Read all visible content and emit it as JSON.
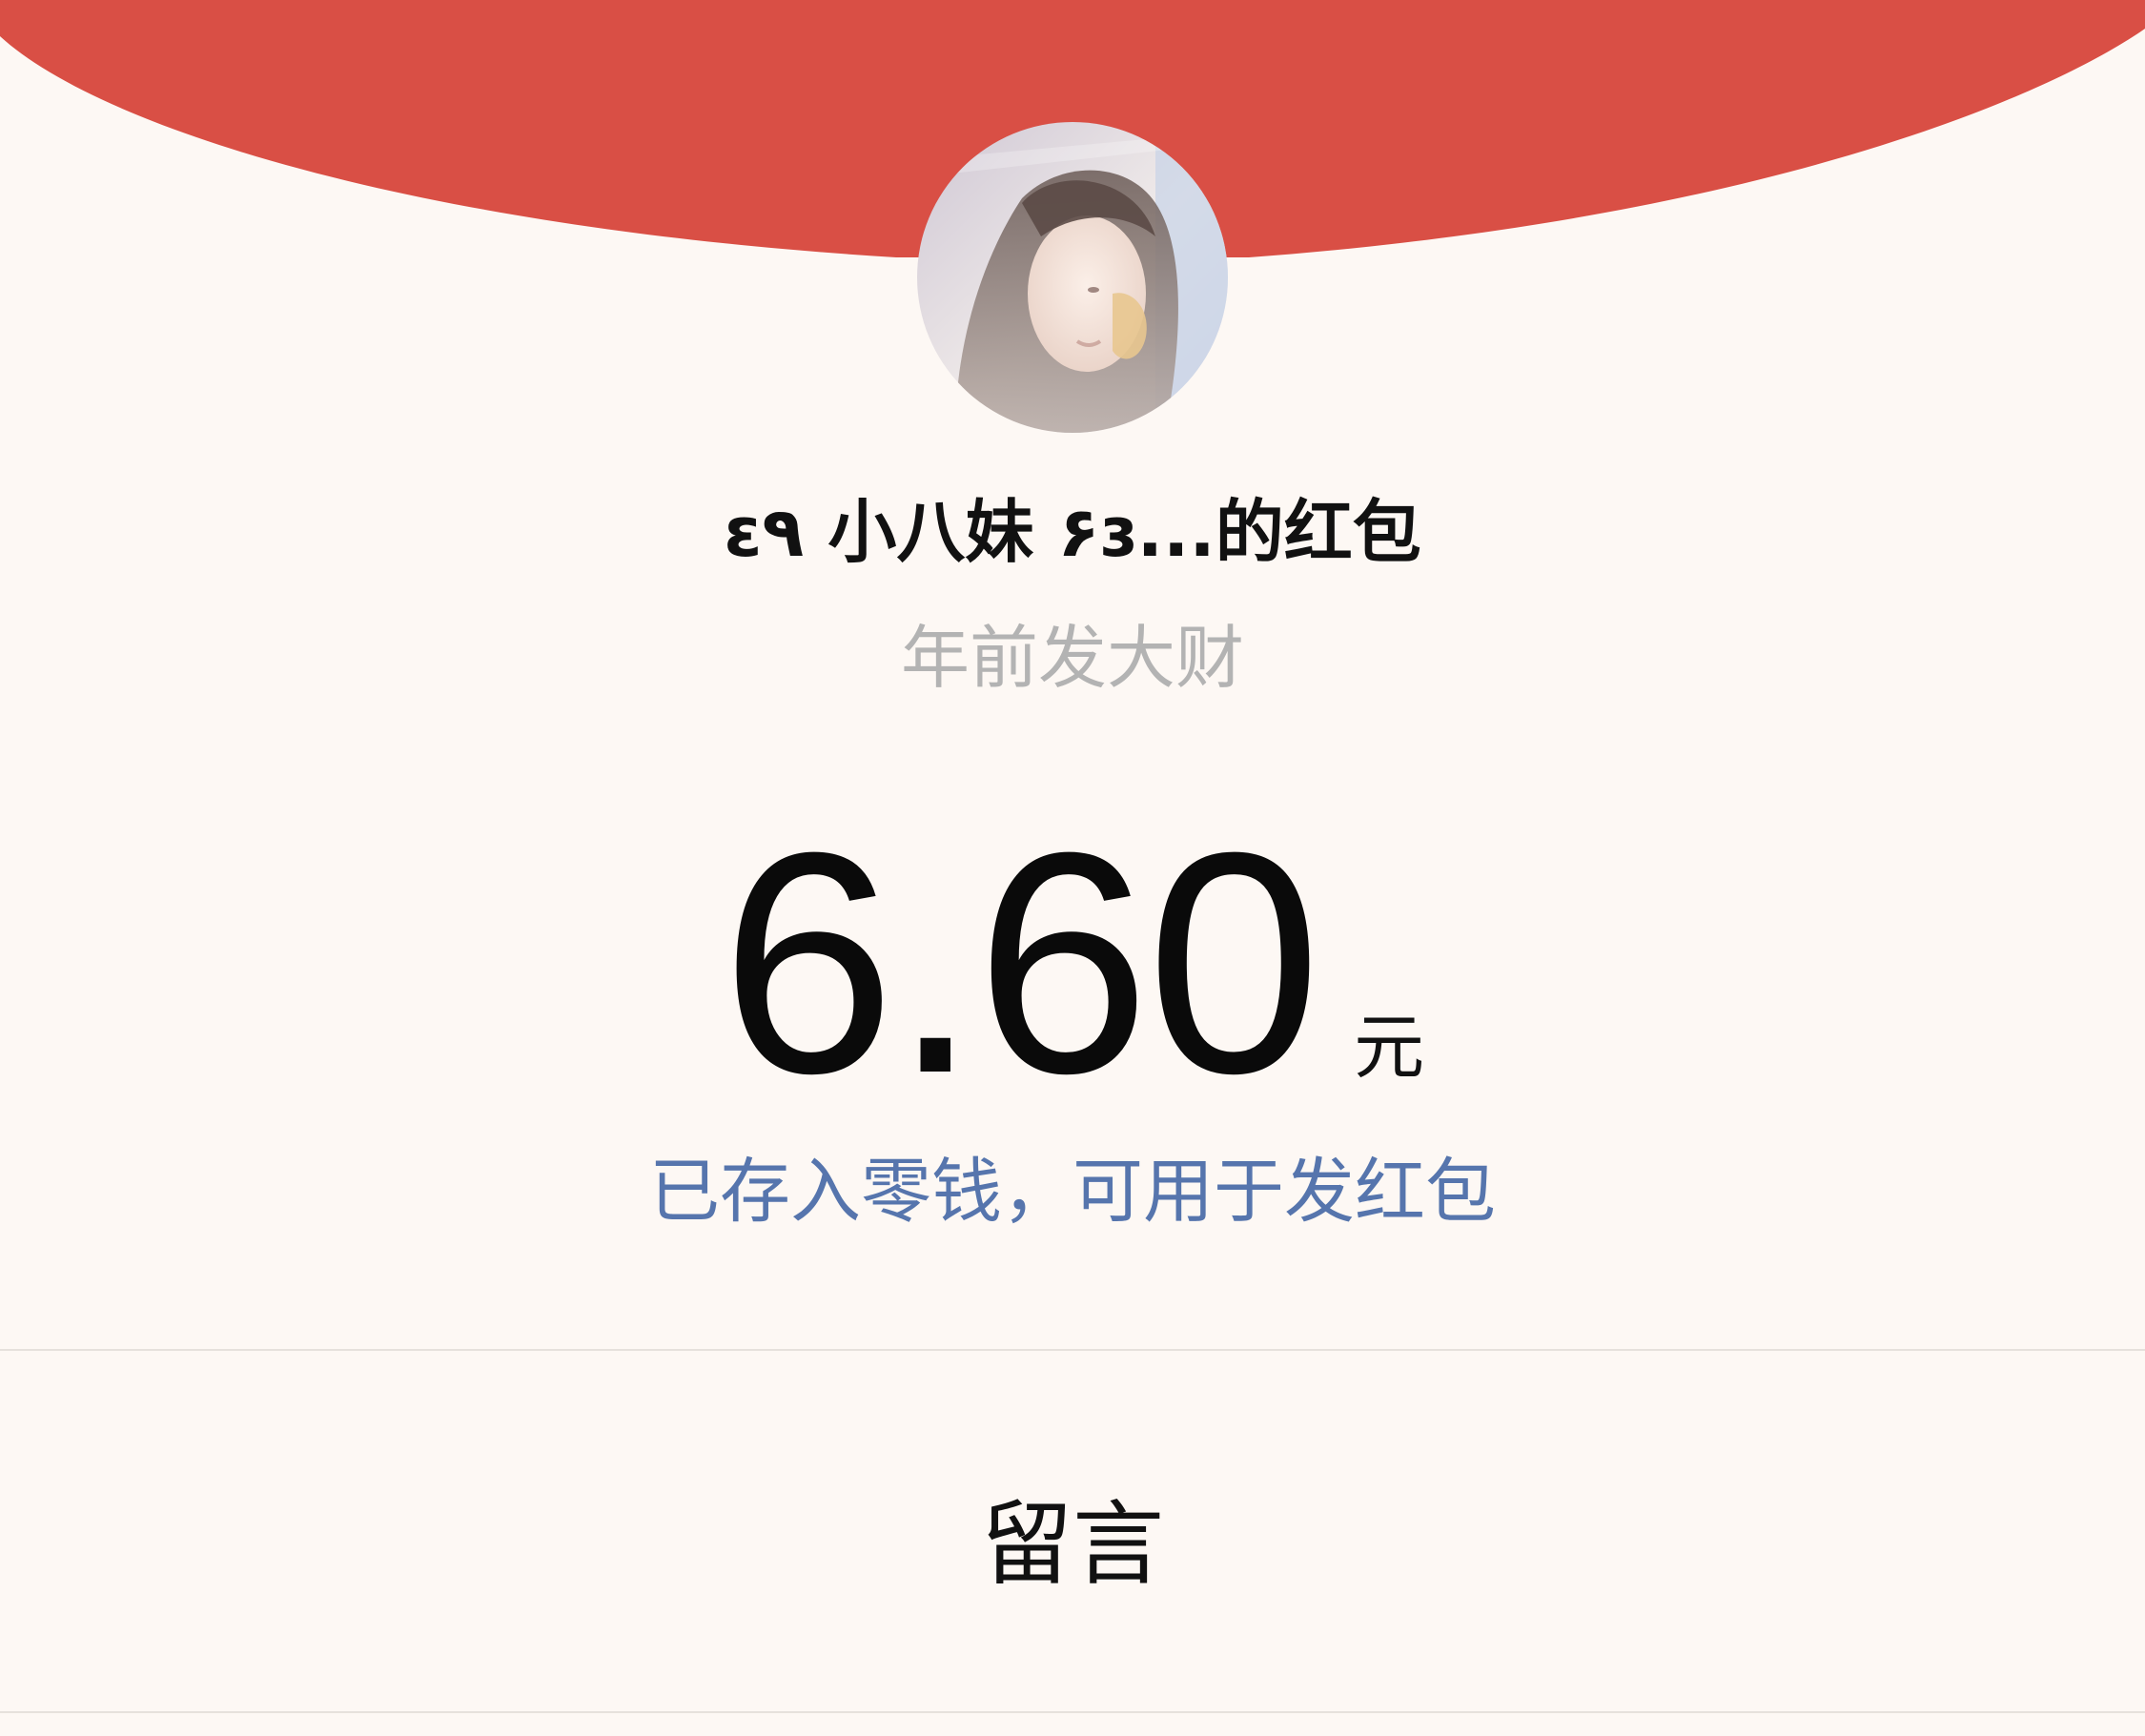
{
  "colors": {
    "header_red": "#d94f45",
    "background": "#fdf8f4",
    "link_blue": "#5675ad",
    "muted_gray": "#b3b3b3"
  },
  "header": {
    "avatar_icon": "avatar-photo"
  },
  "envelope": {
    "sender_title": "ɛ٩ 小八妹 ۶ɜ...的红包",
    "blessing": "年前发大财",
    "amount": "6.60",
    "currency_unit": "元",
    "deposit_note": "已存入零钱，可用于发红包"
  },
  "actions": {
    "message_label": "留言"
  }
}
